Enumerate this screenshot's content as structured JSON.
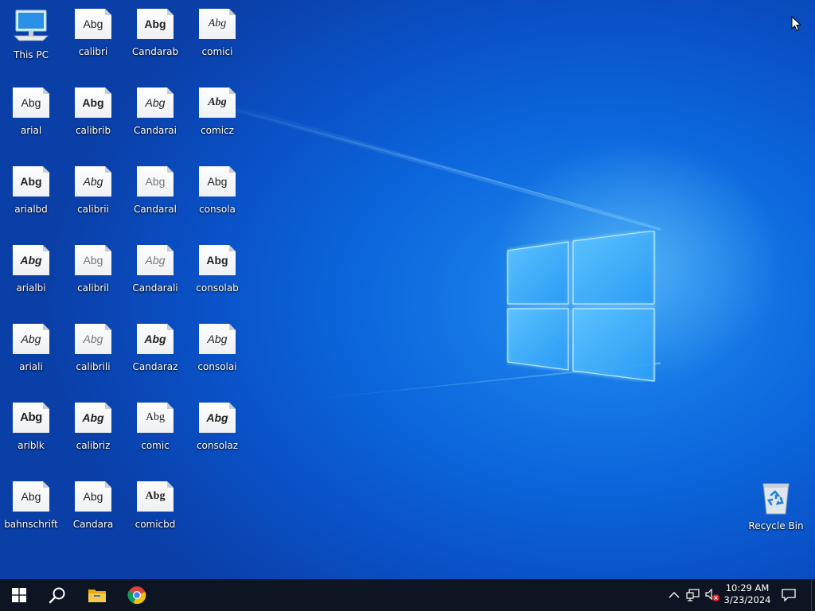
{
  "desktop": {
    "icons": [
      {
        "label": "This PC",
        "kind": "computer"
      },
      {
        "label": "calibri",
        "sample": "Abg",
        "style": "sans"
      },
      {
        "label": "Candarab",
        "sample": "Abg",
        "style": "sans bold"
      },
      {
        "label": "comici",
        "sample": "Abg",
        "style": "serif italic"
      },
      {
        "label": "arial",
        "sample": "Abg",
        "style": "sans"
      },
      {
        "label": "calibrib",
        "sample": "Abg",
        "style": "sans bold"
      },
      {
        "label": "Candarai",
        "sample": "Abg",
        "style": "sans italic"
      },
      {
        "label": "comicz",
        "sample": "Abg",
        "style": "serif bold italic"
      },
      {
        "label": "arialbd",
        "sample": "Abg",
        "style": "sans bold"
      },
      {
        "label": "calibrii",
        "sample": "Abg",
        "style": "sans italic"
      },
      {
        "label": "Candaral",
        "sample": "Abg",
        "style": "sans light"
      },
      {
        "label": "consola",
        "sample": "Abg",
        "style": "sans"
      },
      {
        "label": "arialbi",
        "sample": "Abg",
        "style": "sans bold italic"
      },
      {
        "label": "calibril",
        "sample": "Abg",
        "style": "sans light"
      },
      {
        "label": "Candarali",
        "sample": "Abg",
        "style": "sans light italic"
      },
      {
        "label": "consolab",
        "sample": "Abg",
        "style": "sans bold"
      },
      {
        "label": "ariali",
        "sample": "Abg",
        "style": "sans italic"
      },
      {
        "label": "calibrili",
        "sample": "Abg",
        "style": "sans light italic"
      },
      {
        "label": "Candaraz",
        "sample": "Abg",
        "style": "sans bold italic"
      },
      {
        "label": "consolai",
        "sample": "Abg",
        "style": "sans italic"
      },
      {
        "label": "ariblk",
        "sample": "Abg",
        "style": "sans heavy"
      },
      {
        "label": "calibriz",
        "sample": "Abg",
        "style": "sans bold italic"
      },
      {
        "label": "comic",
        "sample": "Abg",
        "style": "serif"
      },
      {
        "label": "consolaz",
        "sample": "Abg",
        "style": "sans bold italic"
      },
      {
        "label": "bahnschrift",
        "sample": "Abg",
        "style": "sans"
      },
      {
        "label": "Candara",
        "sample": "Abg",
        "style": "sans"
      },
      {
        "label": "comicbd",
        "sample": "Abg",
        "style": "serif bold"
      }
    ],
    "recycle_bin": {
      "label": "Recycle Bin"
    }
  },
  "taskbar": {
    "start_icon": "windows-start-icon",
    "search_icon": "search-icon",
    "pinned": [
      {
        "name": "file-explorer-icon"
      },
      {
        "name": "chrome-icon"
      }
    ],
    "tray": {
      "overflow_icon": "chevron-up-icon",
      "network_icon": "network-icon",
      "volume_icon": "volume-muted-icon",
      "clock": {
        "time": "10:29 AM",
        "date": "3/23/2024"
      },
      "notification_icon": "action-center-icon"
    }
  },
  "colors": {
    "desktop_background": "#0a5bd6",
    "taskbar": "#0e1522",
    "logo_glow": "#8fd8ff"
  }
}
